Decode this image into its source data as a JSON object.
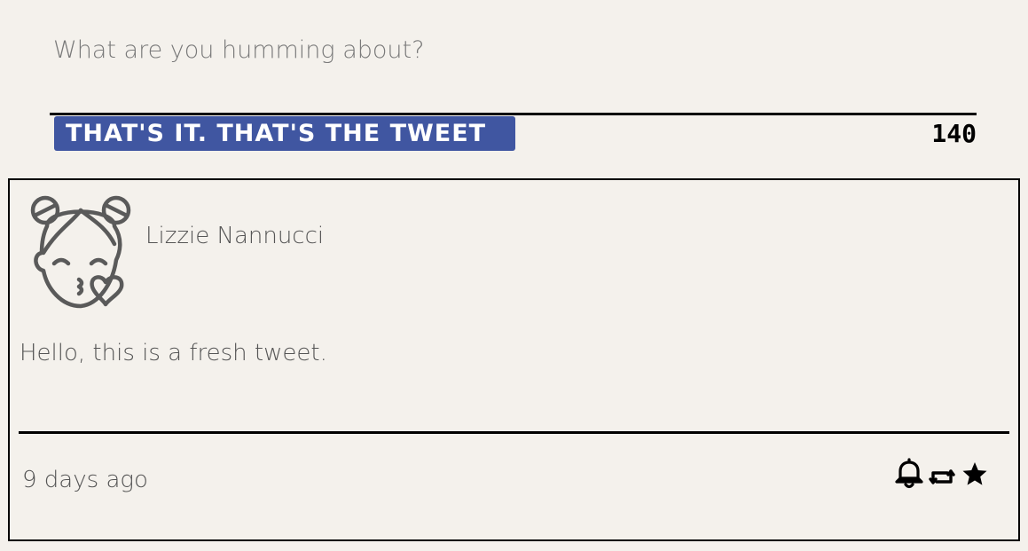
{
  "compose": {
    "placeholder": "What are you humming about?",
    "submit_label": "THAT'S IT. THAT'S THE TWEET",
    "counter": "140"
  },
  "tweet": {
    "author_name": "Lizzie Nannucci",
    "avatar_icon": "kissing-girl-avatar-icon",
    "text": "Hello, this is a fresh tweet.",
    "timestamp": "9 days ago",
    "actions": {
      "flag_icon": "bell-icon",
      "retweet_icon": "retweet-icon",
      "like_icon": "star-icon"
    }
  },
  "colors": {
    "background": "#f4f1ec",
    "button": "#4056a1",
    "text": "#555555"
  }
}
